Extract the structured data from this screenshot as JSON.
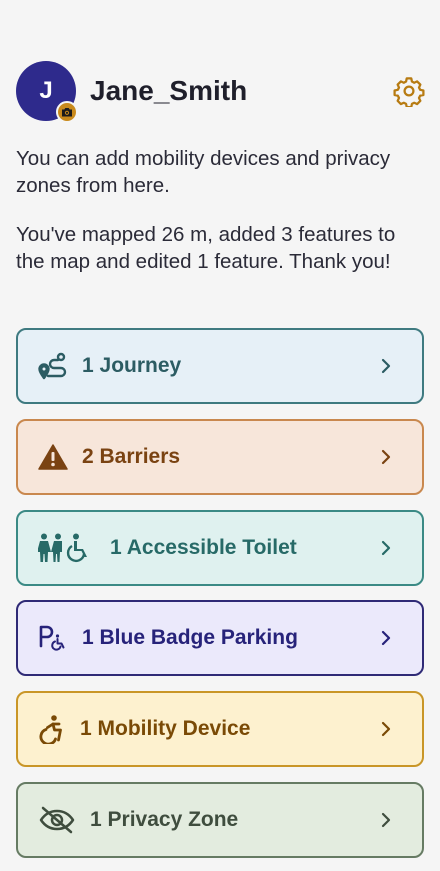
{
  "profile": {
    "avatar_initial": "J",
    "username": "Jane_Smith"
  },
  "intro_text": "You can add mobility devices and privacy zones from here.",
  "stats_text": "You've mapped 26 m, added 3 features to the map and edited 1 feature. Thank you!",
  "colors": {
    "avatar": "#2e2a8c",
    "accent": "#c98a1c"
  },
  "cards": [
    {
      "label": "1 Journey",
      "icon": "route-icon"
    },
    {
      "label": "2 Barriers",
      "icon": "warning-icon"
    },
    {
      "label": "1 Accessible Toilet",
      "icon": "toilet-wheelchair-icon"
    },
    {
      "label": "1 Blue Badge Parking",
      "icon": "accessible-parking-icon"
    },
    {
      "label": "1 Mobility Device",
      "icon": "wheelchair-icon"
    },
    {
      "label": "1 Privacy Zone",
      "icon": "eye-slash-icon"
    }
  ]
}
